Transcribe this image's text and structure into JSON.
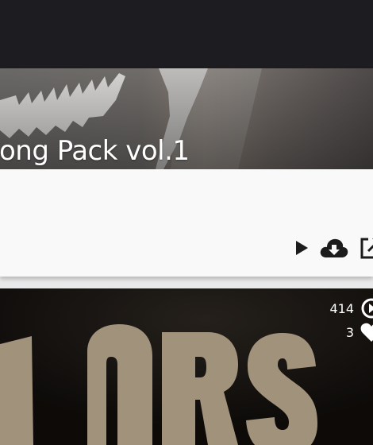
{
  "app": {
    "bar_color": "#1d1c21"
  },
  "card1": {
    "title": "ong Pack vol.1",
    "actions": [
      {
        "name": "play",
        "icon": "play-icon"
      },
      {
        "name": "download",
        "icon": "cloud-download-icon"
      },
      {
        "name": "open-external",
        "icon": "external-link-icon"
      }
    ]
  },
  "card2": {
    "plays": "414",
    "likes": "3",
    "icons": {
      "plays": "play-circle-icon",
      "likes": "heart-icon"
    }
  }
}
